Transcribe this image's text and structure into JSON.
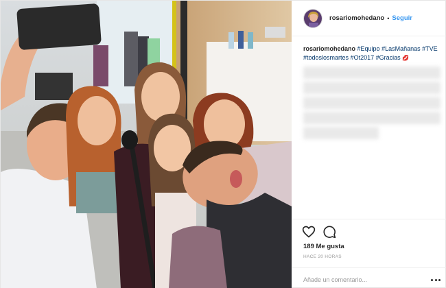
{
  "header": {
    "username": "rosariomohedano",
    "separator": "•",
    "follow_label": "Seguir"
  },
  "caption": {
    "username": "rosariomohedano",
    "hashtags": [
      "#Equipo",
      "#LasMañanas",
      "#TVE",
      "#todoslosmartes",
      "#Ot2017",
      "#Gracias"
    ],
    "emoji": "💋"
  },
  "actions": {
    "like_icon": "heart-icon",
    "comment_icon": "comment-icon",
    "likes_text": "189 Me gusta",
    "time_text": "HACE 20 HORAS"
  },
  "comment_box": {
    "placeholder": "Añade un comentario...",
    "more_icon": "ellipsis-icon"
  },
  "colors": {
    "link_blue": "#3897f0",
    "hashtag_blue": "#003569",
    "muted_gray": "#999999",
    "text_dark": "#262626"
  }
}
